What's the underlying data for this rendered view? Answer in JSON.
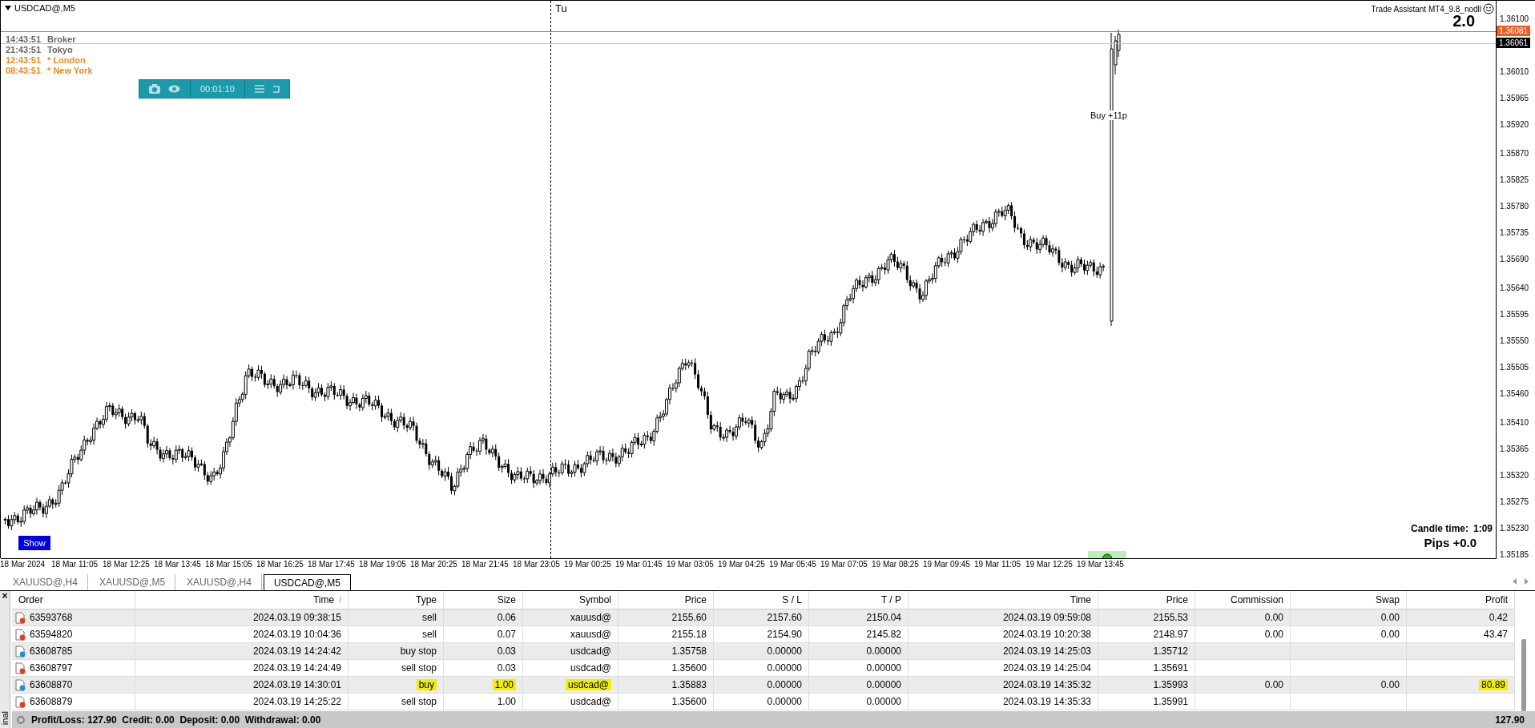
{
  "chart": {
    "symbol": "USDCAD@,M5",
    "separator_label": "Tu",
    "indicator_title": "Trade Assistant MT4_9.8_nodll",
    "big_number": "2.0",
    "clocks": [
      {
        "time": "14:43:51",
        "name": "Broker",
        "active": false
      },
      {
        "time": "21:43:51",
        "name": "Tokyo",
        "active": false
      },
      {
        "time": "12:43:51",
        "name": "* London",
        "active": true
      },
      {
        "time": "08:43:51",
        "name": "* New York",
        "active": true
      }
    ],
    "timer": "00:01:10",
    "trade_label": "Buy +11p",
    "bid_price": "1.36081",
    "ask_price": "1.36061",
    "price_axis": [
      "1.36100",
      "1.36010",
      "1.35965",
      "1.35920",
      "1.35870",
      "1.35825",
      "1.35780",
      "1.35735",
      "1.35690",
      "1.35640",
      "1.35595",
      "1.35550",
      "1.35505",
      "1.35460",
      "1.35410",
      "1.35365",
      "1.35320",
      "1.35275",
      "1.35230",
      "1.35185"
    ],
    "time_axis": [
      "18 Mar 2024",
      "18 Mar 11:05",
      "18 Mar 12:25",
      "18 Mar 13:45",
      "18 Mar 15:05",
      "18 Mar 16:25",
      "18 Mar 17:45",
      "18 Mar 19:05",
      "18 Mar 20:25",
      "18 Mar 21:45",
      "18 Mar 23:05",
      "19 Mar 00:25",
      "19 Mar 01:45",
      "19 Mar 03:05",
      "19 Mar 04:25",
      "19 Mar 05:45",
      "19 Mar 07:05",
      "19 Mar 08:25",
      "19 Mar 09:45",
      "19 Mar 11:05",
      "19 Mar 12:25",
      "19 Mar 13:45"
    ],
    "candle_time_label": "Candle time:",
    "candle_time": "1:09",
    "pips": "Pips +0.0",
    "show_button": "Show"
  },
  "tabs": [
    {
      "label": "XAUUSD@,H4",
      "selected": false
    },
    {
      "label": "XAUUSD@,M5",
      "selected": false
    },
    {
      "label": "XAUUSD@,H4",
      "selected": false
    },
    {
      "label": "USDCAD@,M5",
      "selected": true
    }
  ],
  "terminal": {
    "close": "×",
    "label": "inal"
  },
  "table": {
    "columns": [
      {
        "label": "Order"
      },
      {
        "label": "Time",
        "sort_mark": "/"
      },
      {
        "label": "Type"
      },
      {
        "label": "Size"
      },
      {
        "label": "Symbol"
      },
      {
        "label": "Price"
      },
      {
        "label": "S / L"
      },
      {
        "label": "T / P"
      },
      {
        "label": "Time"
      },
      {
        "label": "Price"
      },
      {
        "label": "Commission"
      },
      {
        "label": "Swap"
      },
      {
        "label": "Profit"
      }
    ],
    "rows": [
      {
        "color": "#e0401a",
        "cells": [
          {
            "text": "63593768",
            "highlighted": false
          },
          {
            "text": "2024.03.19 09:38:15",
            "highlighted": false
          },
          {
            "text": "sell",
            "highlighted": false
          },
          {
            "text": "0.06",
            "highlighted": false
          },
          {
            "text": "xauusd@",
            "highlighted": false
          },
          {
            "text": "2155.60",
            "highlighted": false
          },
          {
            "text": "2157.60",
            "highlighted": false
          },
          {
            "text": "2150.04",
            "highlighted": false
          },
          {
            "text": "2024.03.19 09:59:08",
            "highlighted": false
          },
          {
            "text": "2155.53",
            "highlighted": false
          },
          {
            "text": "0.00",
            "highlighted": false
          },
          {
            "text": "0.00",
            "highlighted": false
          },
          {
            "text": "0.42",
            "highlighted": false
          }
        ]
      },
      {
        "color": "#e0401a",
        "cells": [
          {
            "text": "63594820",
            "highlighted": false
          },
          {
            "text": "2024.03.19 10:04:36",
            "highlighted": false
          },
          {
            "text": "sell",
            "highlighted": false
          },
          {
            "text": "0.07",
            "highlighted": false
          },
          {
            "text": "xauusd@",
            "highlighted": false
          },
          {
            "text": "2155.18",
            "highlighted": false
          },
          {
            "text": "2154.90",
            "highlighted": false
          },
          {
            "text": "2145.82",
            "highlighted": false
          },
          {
            "text": "2024.03.19 10:20:38",
            "highlighted": false
          },
          {
            "text": "2148.97",
            "highlighted": false
          },
          {
            "text": "0.00",
            "highlighted": false
          },
          {
            "text": "0.00",
            "highlighted": false
          },
          {
            "text": "43.47",
            "highlighted": false
          }
        ]
      },
      {
        "color": "#2a8ad8",
        "cells": [
          {
            "text": "63608785",
            "highlighted": false
          },
          {
            "text": "2024.03.19 14:24:42",
            "highlighted": false
          },
          {
            "text": "buy stop",
            "highlighted": false
          },
          {
            "text": "0.03",
            "highlighted": false
          },
          {
            "text": "usdcad@",
            "highlighted": false
          },
          {
            "text": "1.35758",
            "highlighted": false
          },
          {
            "text": "0.00000",
            "highlighted": false
          },
          {
            "text": "0.00000",
            "highlighted": false
          },
          {
            "text": "2024.03.19 14:25:03",
            "highlighted": false
          },
          {
            "text": "1.35712",
            "highlighted": false
          }
        ]
      },
      {
        "color": "#e0401a",
        "cells": [
          {
            "text": "63608797",
            "highlighted": false
          },
          {
            "text": "2024.03.19 14:24:49",
            "highlighted": false
          },
          {
            "text": "sell stop",
            "highlighted": false
          },
          {
            "text": "0.03",
            "highlighted": false
          },
          {
            "text": "usdcad@",
            "highlighted": false
          },
          {
            "text": "1.35600",
            "highlighted": false
          },
          {
            "text": "0.00000",
            "highlighted": false
          },
          {
            "text": "0.00000",
            "highlighted": false
          },
          {
            "text": "2024.03.19 14:25:04",
            "highlighted": false
          },
          {
            "text": "1.35691",
            "highlighted": false
          }
        ]
      },
      {
        "color": "#2a8ad8",
        "cells": [
          {
            "text": "63608870",
            "highlighted": false
          },
          {
            "text": "2024.03.19 14:30:01",
            "highlighted": false
          },
          {
            "text": "buy",
            "highlighted": true
          },
          {
            "text": "1.00",
            "highlighted": true
          },
          {
            "text": "usdcad@",
            "highlighted": true
          },
          {
            "text": "1.35883",
            "highlighted": false
          },
          {
            "text": "0.00000",
            "highlighted": false
          },
          {
            "text": "0.00000",
            "highlighted": false
          },
          {
            "text": "2024.03.19 14:35:32",
            "highlighted": false
          },
          {
            "text": "1.35993",
            "highlighted": false
          },
          {
            "text": "0.00",
            "highlighted": false
          },
          {
            "text": "0.00",
            "highlighted": false
          },
          {
            "text": "80.89",
            "highlighted": true
          }
        ]
      },
      {
        "color": "#e0401a",
        "cells": [
          {
            "text": "63608879",
            "highlighted": false
          },
          {
            "text": "2024.03.19 14:25:22",
            "highlighted": false
          },
          {
            "text": "sell stop",
            "highlighted": false
          },
          {
            "text": "1.00",
            "highlighted": false
          },
          {
            "text": "usdcad@",
            "highlighted": false
          },
          {
            "text": "1.35600",
            "highlighted": false
          },
          {
            "text": "0.00000",
            "highlighted": false
          },
          {
            "text": "0.00000",
            "highlighted": false
          },
          {
            "text": "2024.03.19 14:35:33",
            "highlighted": false
          },
          {
            "text": "1.35991",
            "highlighted": false
          }
        ]
      }
    ]
  },
  "status": {
    "summary": "Profit/Loss: 127.90  Credit: 0.00  Deposit: 0.00  Withdrawal: 0.00",
    "total": "127.90"
  }
}
